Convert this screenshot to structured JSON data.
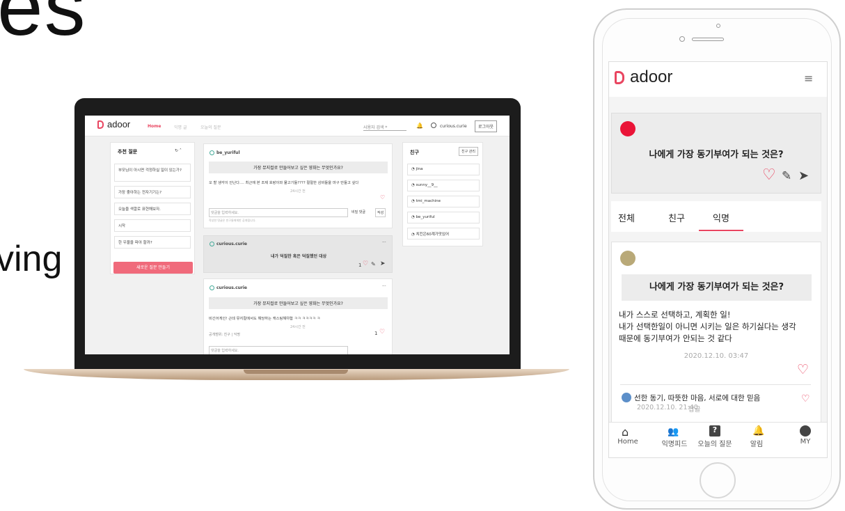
{
  "fragments": {
    "top": "es",
    "mid": "ving"
  },
  "laptop": {
    "brand": "adoor",
    "nav": {
      "home": "Home",
      "tab2": "익명 글",
      "tab3": "오늘의 질문",
      "search_placeholder": "사용자 검색 *",
      "user": "curious.curie",
      "logout": "로그아웃"
    },
    "recommend": {
      "title": "추천 질문",
      "items": [
        "부모님이 아시면 걱정하실 일이 있는가?",
        "가장 좋아하는 전자기기는?",
        "오늘을 색깔로 표현해보자.",
        "시작",
        "한 우물을 파야 할까?"
      ],
      "button": "새로운 질문 만들기"
    },
    "posts": [
      {
        "author": "be_yuriful",
        "question": "가장 뮤지컬로 만들어보고 싶은 영화는 무엇인가요?",
        "answer": "오 할 생각이 안난다.... 최근에 본 조제 호랑이와 물고기들???? 절절한 삼비들을 마구 만들고 싶다",
        "time": "24시간 전",
        "comment_placeholder": "댓글을 입력하세요.",
        "secret": "비밀 댓글",
        "submit": "작성",
        "note": "작성한 댓글은 친구들에게만 공개됩니다."
      },
      {
        "author": "curious.curie",
        "question": "내가 덕질한 혹은 덕질했던 대상",
        "likes": "1"
      },
      {
        "author": "curious.curie",
        "question": "가장 뮤지컬로 만들어보고 싶은 영화는 무엇인가요?",
        "answer": "비긴어게인! 근데 뮤지컬에서도 해당하는 캐스팅해야함 ㅋㅋ ㅋㅋㅋㅋ ㅋ",
        "time": "24시간 전",
        "scope": "공개범위: 친구 | 익명",
        "likes": "1",
        "comment_placeholder": "댓글을 입력하세요."
      }
    ],
    "friends": {
      "title": "친구",
      "manage": "친구 관리",
      "list": [
        "jina",
        "sunny__9__",
        "tmi_machine",
        "be_yuriful",
        "치킨은60계가맛있어"
      ]
    }
  },
  "phone": {
    "brand": "adoor",
    "question_card": {
      "question": "나에게 가장 동기부여가 되는 것은?"
    },
    "tabs": [
      "전체",
      "친구",
      "익명"
    ],
    "active_tab": "익명",
    "answer_card": {
      "question": "나에게 가장 동기부여가 되는 것은?",
      "body": [
        "내가 스스로 선택하고, 계획한 일!",
        "내가 선택한일이 아니면 시키는 일은 하기싫다는 생각",
        "때문에 동기부여가 안되는 것 같다"
      ],
      "timestamp": "2020.12.10. 03:47"
    },
    "comment": {
      "text": "선한 동기, 따뜻한 마음, 서로에 대한 믿음",
      "timestamp": "2020.12.10. 21:40",
      "reply": "답글"
    },
    "bottom_nav": [
      "Home",
      "익명피드",
      "오늘의 질문",
      "알림",
      "MY"
    ],
    "colors": {
      "accent": "#e94560",
      "red_dot": "#ea1437",
      "tan_dot": "#b9a978",
      "blue_dot": "#5c8fc9"
    }
  }
}
